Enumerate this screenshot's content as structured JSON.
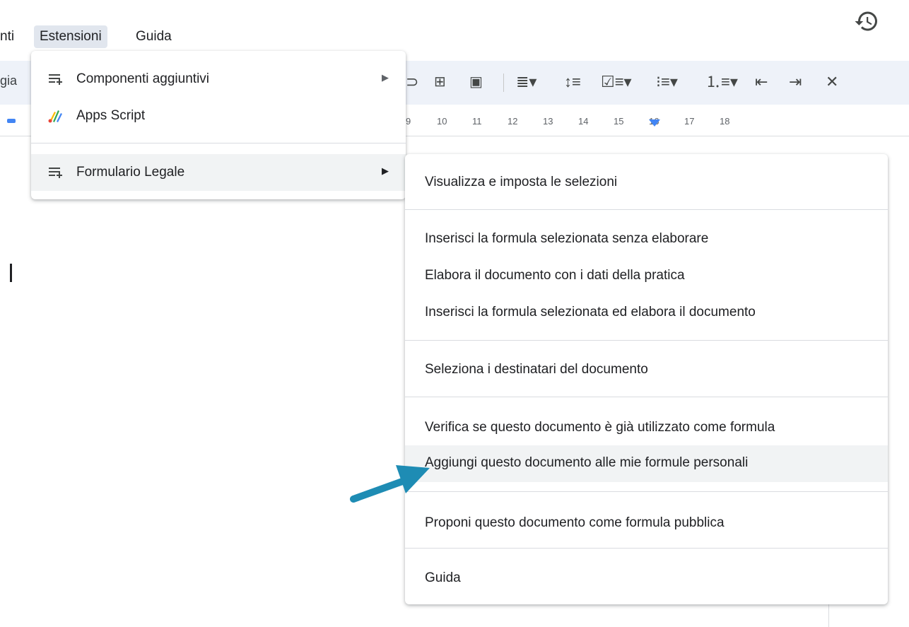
{
  "menubar": {
    "items": [
      "nti",
      "Estensioni",
      "Guida"
    ]
  },
  "toolbar": {
    "partial_label": "gia"
  },
  "ruler": {
    "numbers": [
      "9",
      "10",
      "11",
      "12",
      "13",
      "14",
      "15",
      "16",
      "17",
      "18"
    ]
  },
  "extensions_menu": {
    "items": [
      {
        "label": "Componenti aggiuntivi",
        "icon": "addon-icon",
        "has_submenu": true
      },
      {
        "label": "Apps Script",
        "icon": "apps-script-icon",
        "has_submenu": false
      },
      {
        "label": "Formulario Legale",
        "icon": "addon-icon",
        "has_submenu": true
      }
    ]
  },
  "submenu": {
    "items": [
      "Visualizza e imposta le selezioni",
      "Inserisci la formula selezionata senza elaborare",
      "Elabora il documento con i dati della pratica",
      "Inserisci la formula selezionata ed elabora il documento",
      "Seleziona i destinatari del documento",
      "Verifica se questo documento è già utilizzato come formula",
      "Aggiungi questo documento alle mie formule personali",
      "Proponi questo documento come formula pubblica",
      "Guida"
    ],
    "highlighted_index": 6
  },
  "colors": {
    "accent": "#4285f4",
    "annotation_arrow": "#1e8cb4",
    "toolbar_bg": "#eef2f9"
  }
}
